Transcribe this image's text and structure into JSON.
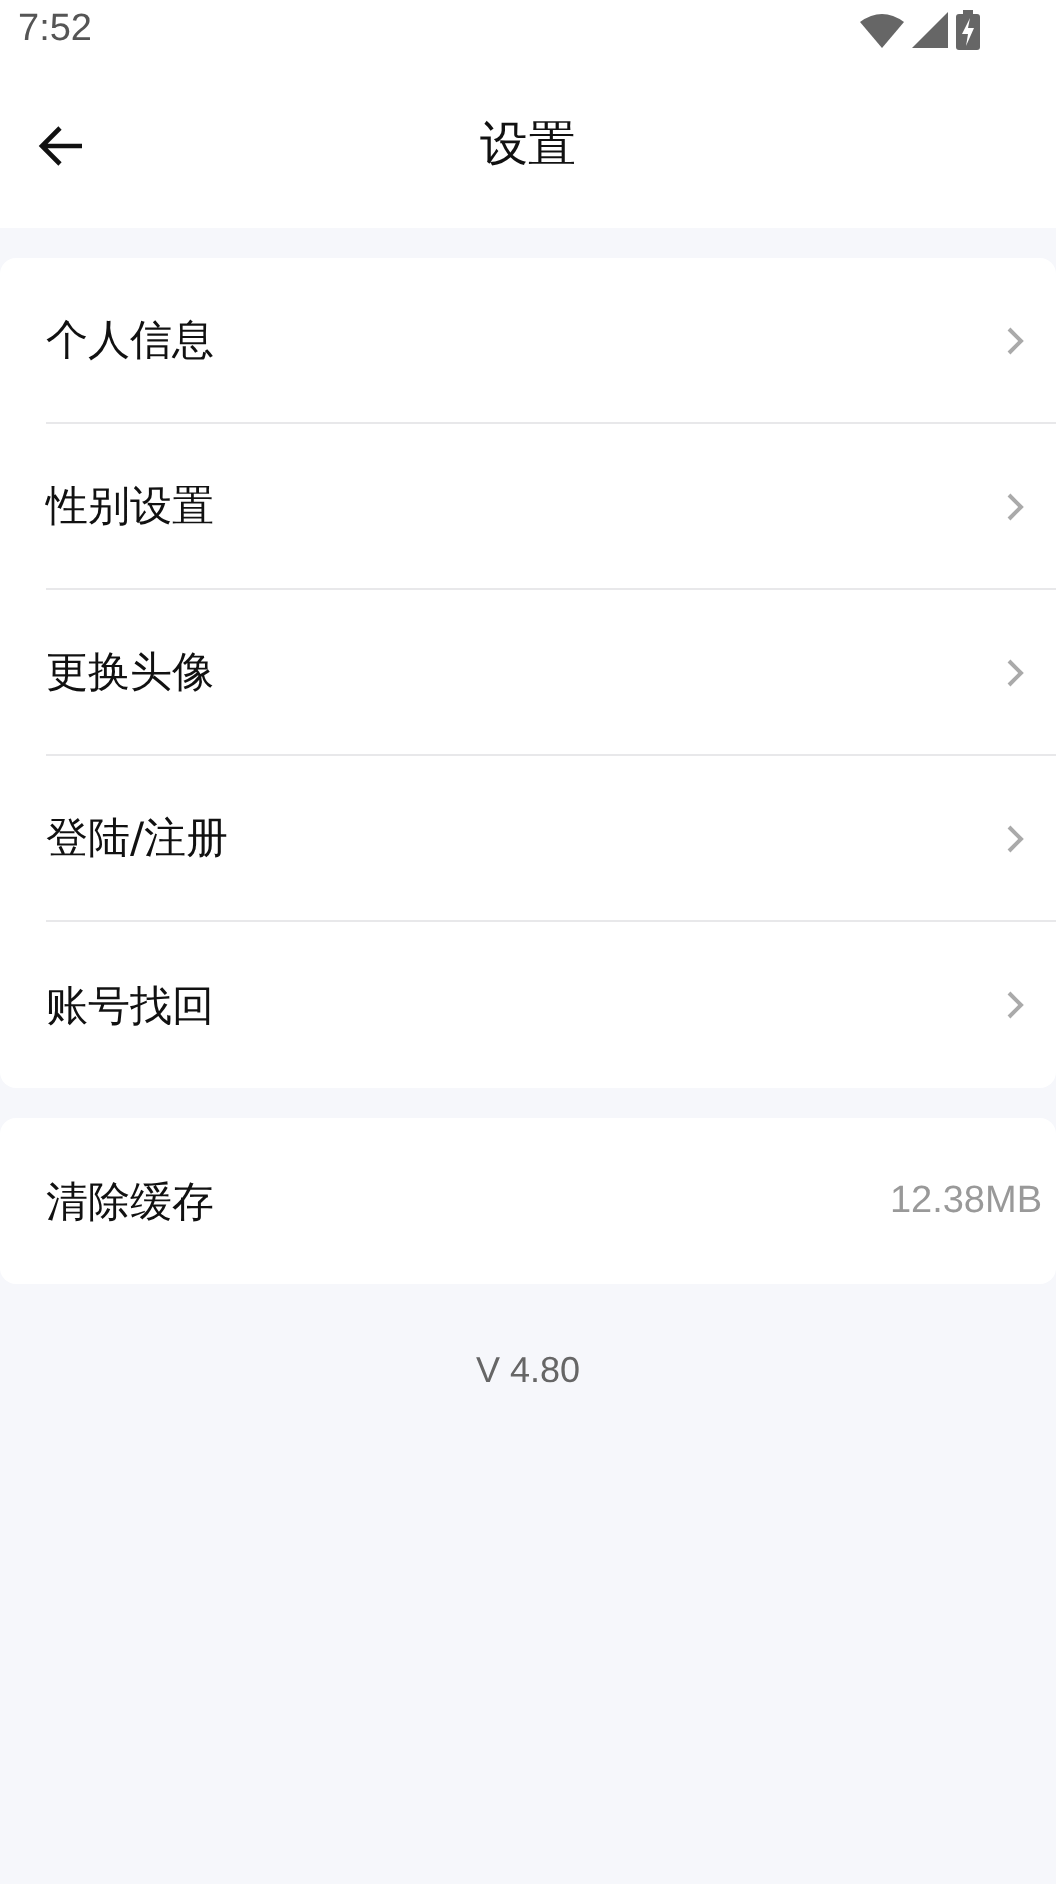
{
  "status_bar": {
    "time": "7:52"
  },
  "header": {
    "title": "设置"
  },
  "groups": [
    {
      "items": [
        {
          "kind": "link",
          "label": "个人信息"
        },
        {
          "kind": "link",
          "label": "性别设置"
        },
        {
          "kind": "link",
          "label": "更换头像"
        },
        {
          "kind": "link",
          "label": "登陆/注册"
        },
        {
          "kind": "link",
          "label": "账号找回"
        }
      ]
    },
    {
      "items": [
        {
          "kind": "value",
          "label": "清除缓存",
          "value": "12.38MB"
        }
      ]
    }
  ],
  "version": "V 4.80"
}
